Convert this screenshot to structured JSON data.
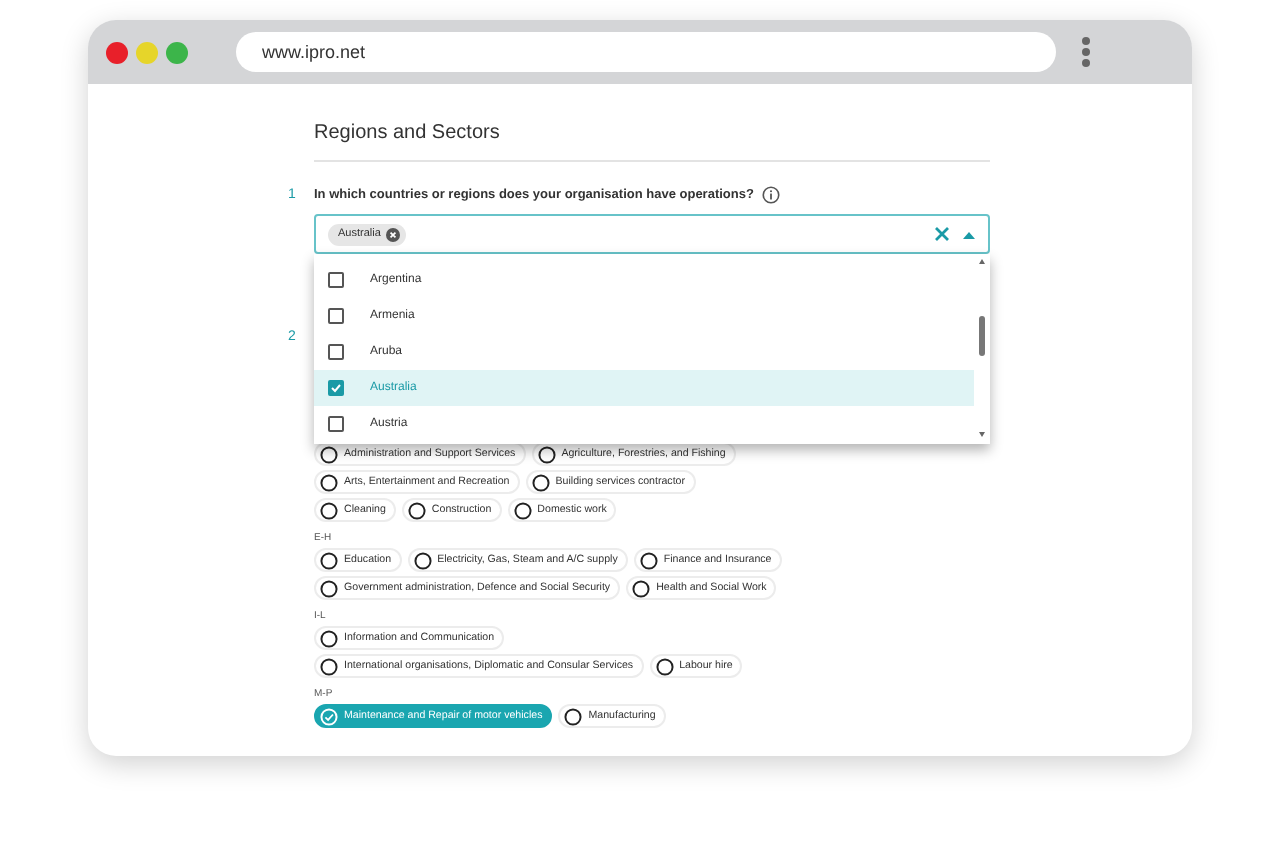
{
  "browser": {
    "url": "www.ipro.net"
  },
  "title": "Regions and Sectors",
  "question_1": {
    "number": "1",
    "label": "In which countries or regions does your organisation have operations?",
    "tags": [
      "Australia"
    ],
    "dropdown": [
      {
        "label": "Argentina",
        "checked": false
      },
      {
        "label": "Armenia",
        "checked": false
      },
      {
        "label": "Aruba",
        "checked": false
      },
      {
        "label": "Australia",
        "checked": true
      },
      {
        "label": "Austria",
        "checked": false
      }
    ]
  },
  "question_2": {
    "number": "2",
    "groups": [
      {
        "rows": [
          {
            "options": [
              {
                "label": "Administration and Support Services",
                "selected": false
              },
              {
                "label": "Agriculture, Forestries, and Fishing",
                "selected": false
              }
            ]
          },
          {
            "options": [
              {
                "label": "Arts, Entertainment and Recreation",
                "selected": false
              },
              {
                "label": "Building services contractor",
                "selected": false
              }
            ]
          },
          {
            "options": [
              {
                "label": "Cleaning",
                "selected": false
              },
              {
                "label": "Construction",
                "selected": false
              },
              {
                "label": "Domestic work",
                "selected": false
              }
            ]
          }
        ]
      },
      {
        "heading": "E-H",
        "rows": [
          {
            "options": [
              {
                "label": "Education",
                "selected": false
              },
              {
                "label": "Electricity, Gas, Steam and A/C supply",
                "selected": false
              },
              {
                "label": "Finance and Insurance",
                "selected": false
              }
            ]
          },
          {
            "options": [
              {
                "label": "Government administration, Defence and Social Security",
                "selected": false
              },
              {
                "label": "Health and Social Work",
                "selected": false
              }
            ]
          }
        ]
      },
      {
        "heading": "I-L",
        "rows": [
          {
            "options": [
              {
                "label": "Information and Communication",
                "selected": false
              }
            ]
          },
          {
            "options": [
              {
                "label": "International organisations, Diplomatic and Consular Services",
                "selected": false
              },
              {
                "label": "Labour hire",
                "selected": false
              }
            ]
          }
        ]
      },
      {
        "heading": "M-P",
        "rows": [
          {
            "options": [
              {
                "label": "Maintenance and Repair of motor vehicles",
                "selected": true
              },
              {
                "label": "Manufacturing",
                "selected": false
              }
            ]
          }
        ]
      }
    ]
  }
}
